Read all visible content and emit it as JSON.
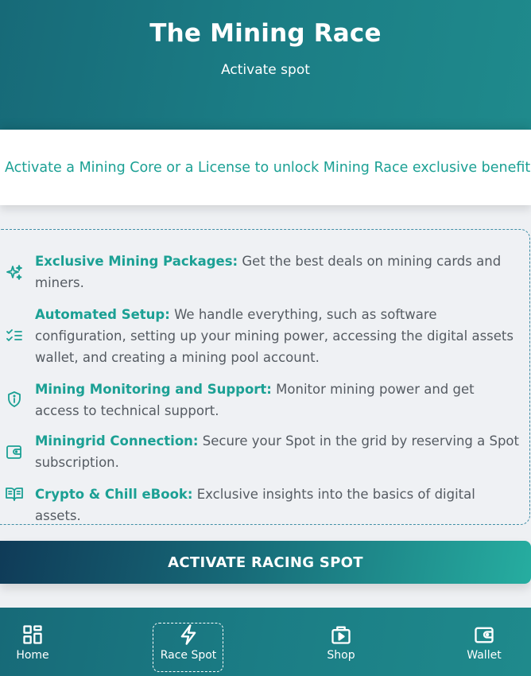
{
  "header": {
    "title": "The Mining Race",
    "subtitle": "Activate spot"
  },
  "intro": {
    "text": "Activate a Mining Core or a License to unlock Mining Race exclusive benefits:"
  },
  "benefits": [
    {
      "icon": "sparkles-icon",
      "title": "Exclusive Mining Packages:",
      "text": " Get the best deals on mining cards and miners."
    },
    {
      "icon": "checklist-icon",
      "title": "Automated Setup:",
      "text": " We handle everything, such as software configuration, setting up your mining power, accessing the digital assets wallet, and creating a mining pool account."
    },
    {
      "icon": "shield-info-icon",
      "title": "Mining Monitoring and Support:",
      "text": " Monitor mining power and get access to technical support."
    },
    {
      "icon": "wallet-icon",
      "title": "Miningrid Connection:",
      "text": " Secure your Spot in the grid by reserving a Spot subscription."
    },
    {
      "icon": "book-icon",
      "title": "Crypto & Chill eBook:",
      "text": " Exclusive insights into the basics of digital assets."
    }
  ],
  "cta": {
    "label": "ACTIVATE RACING SPOT"
  },
  "nav": {
    "items": [
      {
        "label": "Home",
        "icon": "grid-icon"
      },
      {
        "label": "Race Spot",
        "icon": "lightning-icon",
        "active": true
      },
      {
        "label": "Shop",
        "icon": "shop-play-icon"
      },
      {
        "label": "Wallet",
        "icon": "wallet-icon"
      }
    ]
  },
  "colors": {
    "accent": "#1ba094",
    "header": "#1b7d85",
    "text": "#555b62"
  }
}
